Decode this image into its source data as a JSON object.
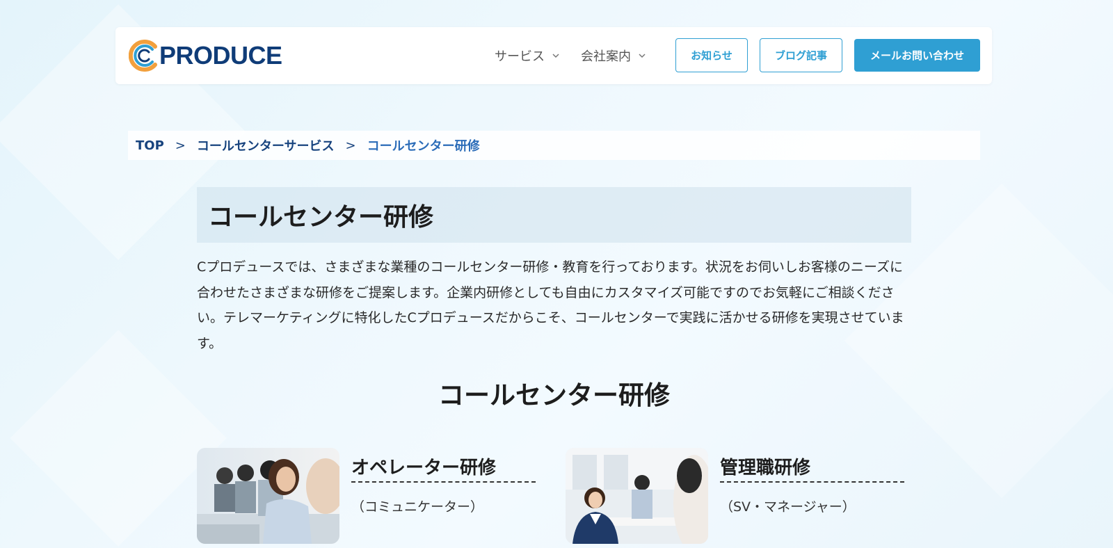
{
  "header": {
    "logo_text": "PRODUCE",
    "nav": [
      {
        "label": "サービス"
      },
      {
        "label": "会社案内"
      }
    ],
    "news_button": "お知らせ",
    "blog_button": "ブログ記事",
    "mail_button": "メールお問い合わせ"
  },
  "breadcrumb": {
    "items": [
      "TOP",
      "コールセンターサービス",
      "コールセンター研修"
    ],
    "separator": ">"
  },
  "page": {
    "title": "コールセンター研修",
    "intro": "Cプロデュースでは、さまざまな業種のコールセンター研修・教育を行っております。状況をお伺いしお客様のニーズに合わせたさまざまな研修をご提案します。企業内研修としても自由にカスタマイズ可能ですのでお気軽にご相談ください。テレマーケティングに特化したCプロデュースだからこそ、コールセンターで実践に活かせる研修を実現させています。",
    "section_title": "コールセンター研修"
  },
  "cards": [
    {
      "title": "オペレーター研修",
      "subtitle": "（コミュニケーター）"
    },
    {
      "title": "管理職研修",
      "subtitle": "（SV・マネージャー）"
    }
  ],
  "colors": {
    "brand_navy": "#0f3c78",
    "accent_blue": "#2f9fd3",
    "logo_orange": "#f2a03d"
  },
  "icons": {
    "logo": "c-produce-logo-icon",
    "dropdown": "chevron-down-icon"
  }
}
